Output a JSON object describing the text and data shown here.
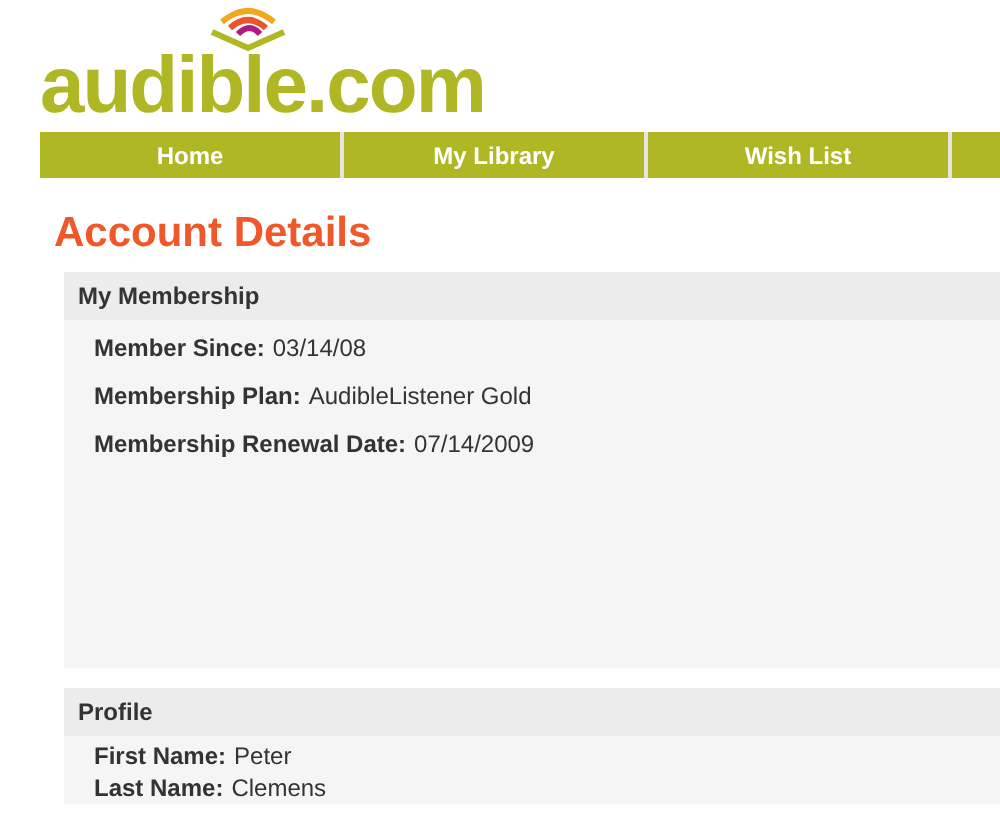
{
  "logo": {
    "text": "audible.com"
  },
  "nav": [
    {
      "label": "Home"
    },
    {
      "label": "My Library"
    },
    {
      "label": "Wish List"
    }
  ],
  "page_title": "Account Details",
  "sections": [
    {
      "title": "My Membership",
      "tall": true,
      "fields": [
        {
          "label": "Member Since:",
          "value": "03/14/08"
        },
        {
          "label": "Membership Plan:",
          "value": "AudibleListener Gold"
        },
        {
          "label": "Membership Renewal Date:",
          "value": "07/14/2009"
        }
      ]
    },
    {
      "title": "Profile",
      "tall": false,
      "fields": [
        {
          "label": "First Name:",
          "value": "Peter"
        },
        {
          "label": "Last Name:",
          "value": "Clemens"
        }
      ]
    }
  ]
}
